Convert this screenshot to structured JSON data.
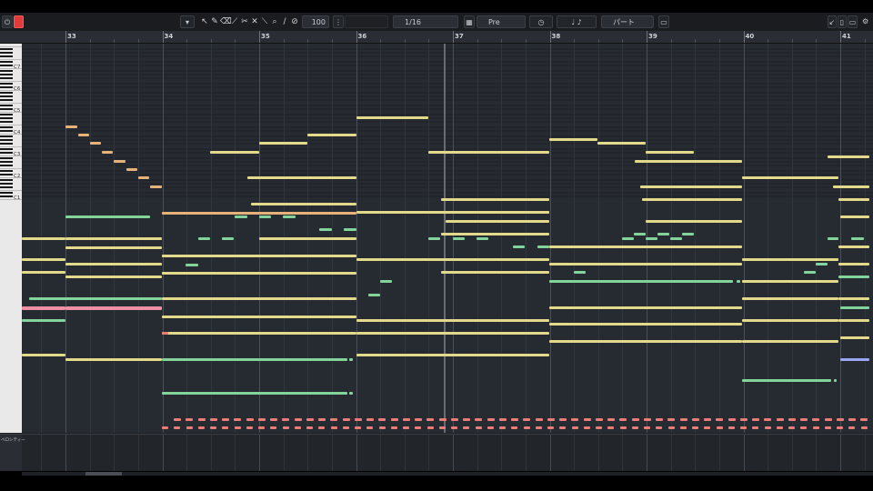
{
  "toolbar": {
    "record_icon": "record-icon",
    "power_icon": "power-icon",
    "velocity_value": "100",
    "quantize_value": "1/16",
    "chord_label": "Pre",
    "color_label": "パート"
  },
  "ruler": {
    "bars": [
      "33",
      "34",
      "35",
      "36",
      "37",
      "38",
      "39",
      "40",
      "41"
    ]
  },
  "keyboard": {
    "octave_labels": [
      "C7",
      "C6",
      "C5",
      "C4",
      "C3",
      "C2",
      "C1"
    ]
  },
  "controller_lane": {
    "label": "ベロシティー"
  },
  "colors": {
    "yellow": "#e3d98a",
    "orange": "#e7b17a",
    "green": "#82d49a",
    "pink": "#ef8fa3",
    "red": "#ec7c78",
    "blue": "#9aa6f2"
  }
}
